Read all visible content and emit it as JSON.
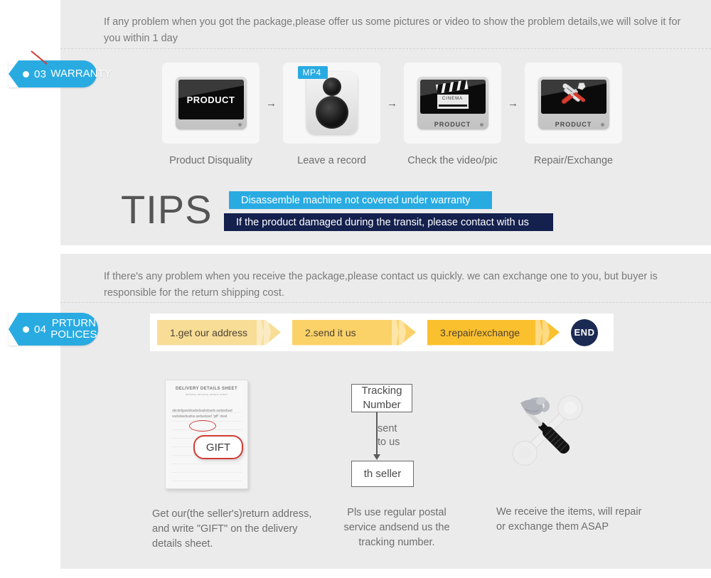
{
  "sections": {
    "warranty": {
      "tag": {
        "number": "03",
        "label": "WARRANTY"
      },
      "intro": "If any problem when you got the package,please offer us some pictures or video to show the problem details,we will solve it for you within 1 day",
      "steps": [
        {
          "caption": "Product Disquality",
          "icon": "monitor-product-icon",
          "screen_label": "PRODUCT"
        },
        {
          "caption": "Leave a record",
          "icon": "mp4-recorder-icon",
          "badge": "MP4"
        },
        {
          "caption": "Check the video/pic",
          "icon": "monitor-clapperboard-icon",
          "bezel_label": "PRODUCT",
          "clapper_label": "CINEMA"
        },
        {
          "caption": "Repair/Exchange",
          "icon": "monitor-tools-icon",
          "bezel_label": "PRODUCT"
        }
      ],
      "step_separator": "→",
      "tips": {
        "word": "TIPS",
        "bars": [
          {
            "text": "Disassemble machine not covered under warranty",
            "color": "#29abe2"
          },
          {
            "text": "If the product damaged during the transit, please contact with us",
            "color": "#14204d"
          }
        ]
      }
    },
    "returns": {
      "tag": {
        "number": "04",
        "label": "PRTURN\nPOLICES"
      },
      "intro": "If  there's any problem when you receive the package,please contact us quickly. we can exchange one to you, but buyer is responsible for the return shipping cost.",
      "flow": {
        "steps": [
          {
            "label": "1.get our address",
            "color": "#f8dd97"
          },
          {
            "label": "2.send it us",
            "color": "#fbd268"
          },
          {
            "label": "3.repair/exchange",
            "color": "#fbc02d"
          }
        ],
        "end_label": "END",
        "end_color": "#1b2a52"
      },
      "columns": [
        {
          "icon": "delivery-sheet-icon",
          "sheet": {
            "title": "DELIVERY DETAILS SHEET",
            "subtitle": "delivery       delivery details sheet",
            "body_text": "abcdefgasddsadsdsadsdsads asdasdsadsadsdasdsadsa asdasdasd \"gift\" dsad",
            "callout": "GIFT"
          },
          "caption": "Get our(the seller's)return address, and write \"GIFT\" on the delivery details sheet."
        },
        {
          "icon": "tracking-flow-icon",
          "flow": {
            "from": "Tracking Number",
            "connector": "sent\nto us",
            "to": "th seller"
          },
          "caption": "Pls use regular postal service andsend us the tracking number."
        },
        {
          "icon": "hammer-wrench-icon",
          "caption": "We receive the items, will repair or exchange them ASAP"
        }
      ]
    }
  },
  "colors": {
    "accent_blue": "#29abe2",
    "navy": "#14204d",
    "panel_grey": "#ebebeb",
    "yellow": "#fbc02d",
    "red": "#d23b34"
  }
}
